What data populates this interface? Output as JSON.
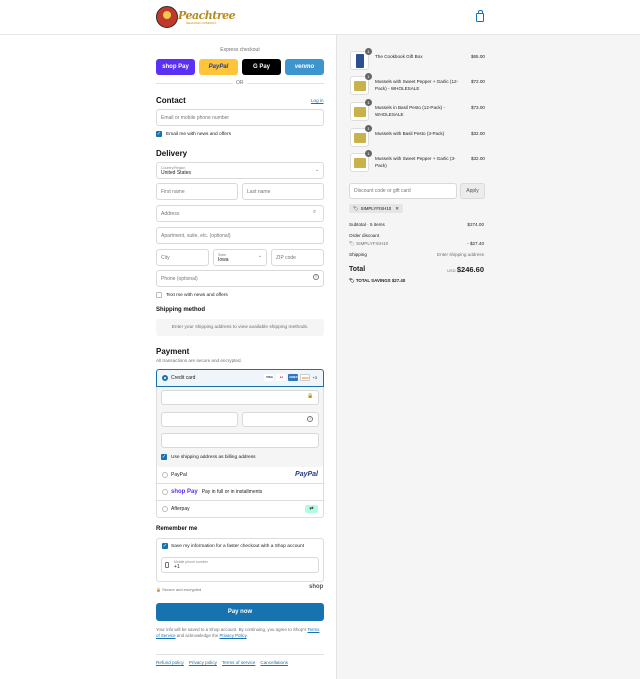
{
  "header": {
    "logo_text": "Peachtree",
    "logo_sub": "SEAFOOD COMPANY",
    "cart_icon": "shopping-bag-icon"
  },
  "express": {
    "title": "Express checkout",
    "buttons": [
      "shop Pay",
      "PayPal",
      "G Pay",
      "venmo"
    ],
    "or": "OR",
    "colors": {
      "shop": "#5a31f4",
      "paypal": "#ffc439",
      "gpay": "#000000",
      "venmo": "#3d95ce"
    }
  },
  "contact": {
    "title": "Contact",
    "login": "Log in",
    "email_placeholder": "Email or mobile phone number",
    "news_label": "Email me with news and offers"
  },
  "delivery": {
    "title": "Delivery",
    "country_caption": "Country/Region",
    "country_value": "United States",
    "first_name": "First name",
    "last_name": "Last name",
    "address": "Address",
    "apartment": "Apartment, suite, etc. (optional)",
    "city": "City",
    "state_caption": "State",
    "state_value": "Iowa",
    "zip": "ZIP code",
    "phone": "Phone (optional)",
    "text_me": "Text me with news and offers"
  },
  "shipping": {
    "title": "Shipping method",
    "note": "Enter your shipping address to view available shipping methods."
  },
  "payment": {
    "title": "Payment",
    "subtitle": "All transactions are secure and encrypted.",
    "credit_card": "Credit card",
    "card_brands": [
      "VISA",
      "MC",
      "AMEX",
      "DISC"
    ],
    "more_cards": "+3",
    "billing_label": "Use shipping address as billing address",
    "paypal": "PayPal",
    "shop_pay": "shop Pay",
    "shop_pay_desc": "Pay in full or in installments",
    "afterpay": "Afterpay"
  },
  "remember": {
    "title": "Remember me",
    "save_label": "Save my information for a faster checkout with a Shop account",
    "phone_caption": "Mobile phone number",
    "phone_value": "+1",
    "secure": "Secure and encrypted",
    "shop": "shop"
  },
  "pay_now": "Pay now",
  "legal": {
    "line1": "Your info will be saved to a Shop account. By continuing, you agree to Shop's",
    "terms": "Terms of Service",
    "and": "and acknowledge the",
    "privacy": "Privacy Policy",
    "end": "."
  },
  "footer_links": [
    "Refund policy",
    "Privacy policy",
    "Terms of service",
    "Cancellations"
  ],
  "items": [
    {
      "name": "The Cookbook Gift Box",
      "price": "$65.00",
      "qty": "1"
    },
    {
      "name": "Mussels with Sweet Pepper + Garlic (12-Pack) - WHOLESALE",
      "price": "$72.00",
      "qty": "1"
    },
    {
      "name": "Mussels in Basil Pesto (12-Pack) - WHOLESALE",
      "price": "$73.00",
      "qty": "1"
    },
    {
      "name": "Mussels with Basil Pesto (3-Pack)",
      "price": "$32.00",
      "qty": "1"
    },
    {
      "name": "Mussels with Sweet Pepper + Garlic (3-Pack)",
      "price": "$32.00",
      "qty": "1"
    }
  ],
  "discount": {
    "placeholder": "Discount code or gift card",
    "apply": "Apply",
    "code": "SIMPLYFISH10"
  },
  "totals": {
    "subtotal_label": "Subtotal · 5 items",
    "subtotal": "$274.00",
    "order_discount": "Order discount",
    "discount_code": "SIMPLYFISH10",
    "discount_value": "- $27.40",
    "shipping_label": "Shipping",
    "shipping_value": "Enter shipping address",
    "total_label": "Total",
    "currency": "USD",
    "total": "$246.60",
    "savings_label": "TOTAL SAVINGS",
    "savings": "$27.40"
  }
}
